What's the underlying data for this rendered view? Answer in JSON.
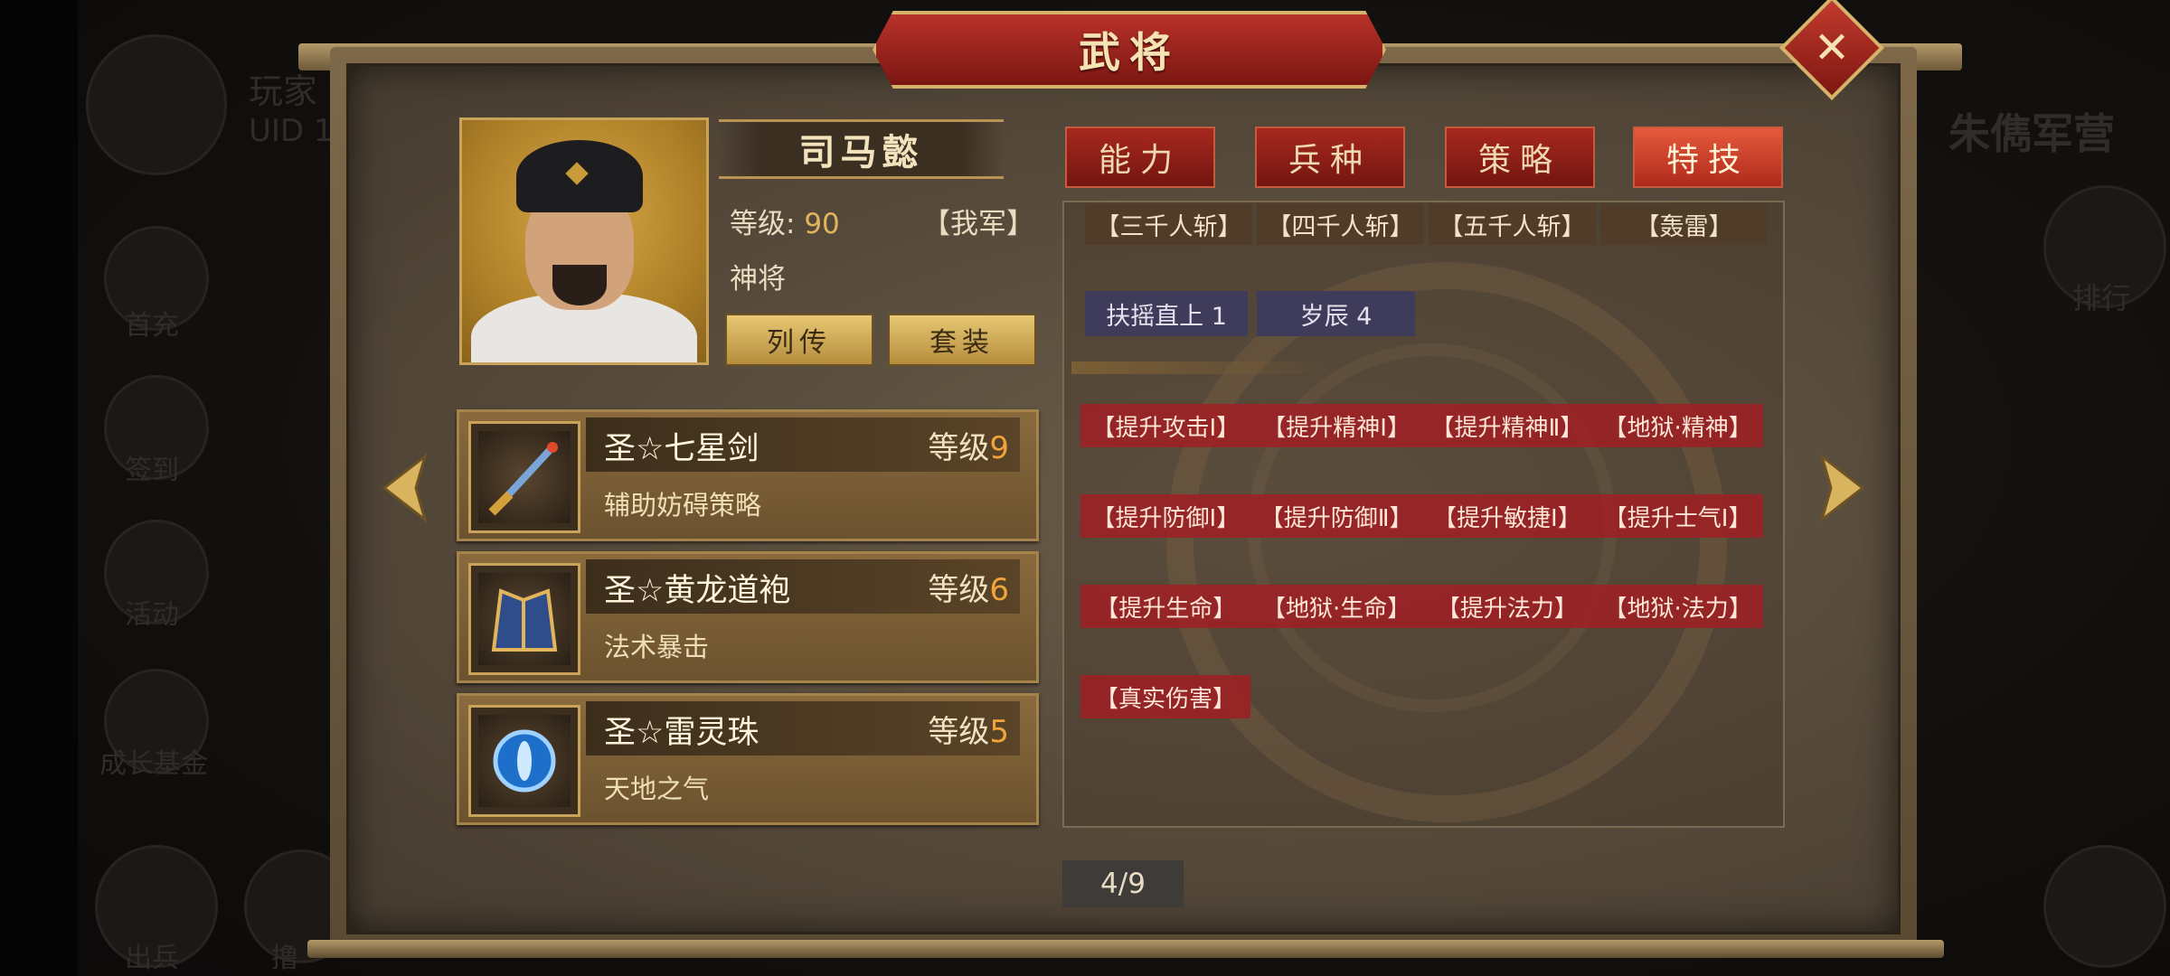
{
  "background": {
    "player_name": "玩家",
    "uid_label": "UID 1",
    "right_title": "朱儁军营",
    "left_menu": [
      "首充",
      "签到",
      "活动",
      "成长基金",
      "出兵",
      "撸"
    ],
    "right_menu": [
      "排行"
    ]
  },
  "dialog": {
    "title": "武将",
    "close_label": "✕"
  },
  "general": {
    "name": "司马懿",
    "level_label": "等级:",
    "level_value": "90",
    "faction": "【我军】",
    "rank": "神将",
    "btn_biography": "列传",
    "btn_set": "套装"
  },
  "equipment": [
    {
      "name": "圣☆七星剑",
      "level_label": "等级",
      "level": "9",
      "desc": "辅助妨碍策略",
      "icon": "sword-icon"
    },
    {
      "name": "圣☆黄龙道袍",
      "level_label": "等级",
      "level": "6",
      "desc": "法术暴击",
      "icon": "robe-icon"
    },
    {
      "name": "圣☆雷灵珠",
      "level_label": "等级",
      "level": "5",
      "desc": "天地之气",
      "icon": "orb-icon"
    }
  ],
  "tabs": [
    {
      "label": "能力",
      "active": false
    },
    {
      "label": "兵种",
      "active": false
    },
    {
      "label": "策略",
      "active": false
    },
    {
      "label": "特技",
      "active": true
    }
  ],
  "skills_top": [
    "【三千人斩】",
    "【四千人斩】",
    "【五千人斩】",
    "【轰雷】"
  ],
  "abilities": [
    "扶摇直上 1",
    "岁辰 4"
  ],
  "skill_rows": [
    [
      "【提升攻击Ⅰ】",
      "【提升精神Ⅰ】",
      "【提升精神Ⅱ】",
      "【地狱·精神】"
    ],
    [
      "【提升防御Ⅰ】",
      "【提升防御Ⅱ】",
      "【提升敏捷Ⅰ】",
      "【提升士气Ⅰ】"
    ],
    [
      "【提升生命】",
      "【地狱·生命】",
      "【提升法力】",
      "【地狱·法力】"
    ],
    [
      "【真实伤害】"
    ]
  ],
  "pagination": "4/9",
  "colors": {
    "accent_red": "#a7281f",
    "gold": "#e2b55a",
    "level_orange": "#f0a43a"
  }
}
